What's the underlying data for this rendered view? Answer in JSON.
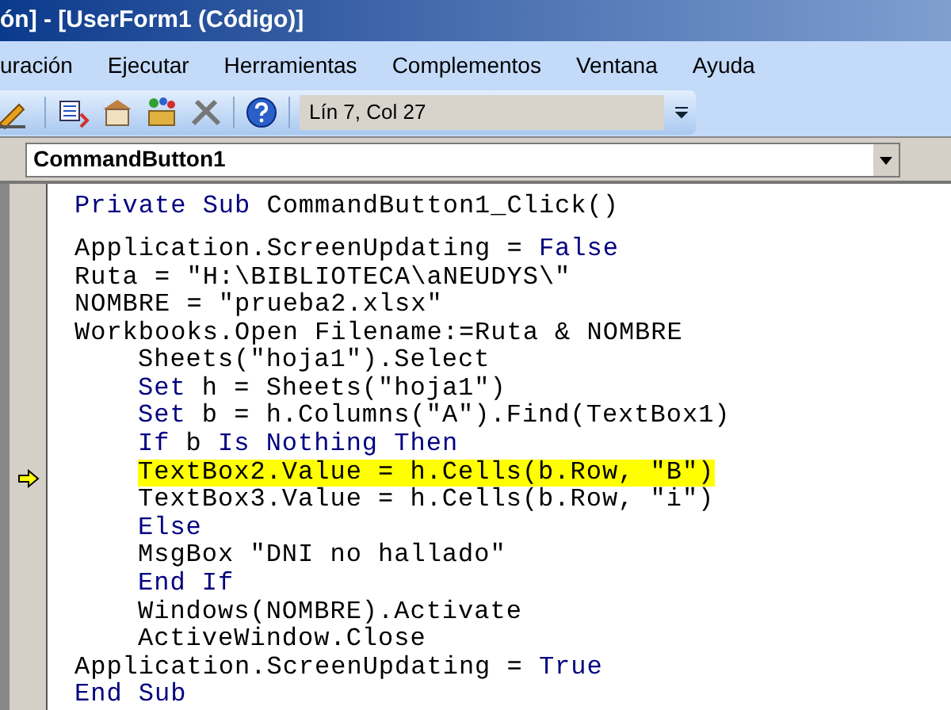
{
  "window": {
    "title": "ón] - [UserForm1 (Código)]"
  },
  "menu": [
    "uración",
    "Ejecutar",
    "Herramientas",
    "Complementos",
    "Ventana",
    "Ayuda"
  ],
  "toolbar": {
    "position": "Lín 7, Col 27"
  },
  "object_dropdown": {
    "value": "CommandButton1"
  },
  "code": [
    {
      "kind": "code",
      "current": false,
      "tokens": [
        {
          "kind": "keyword",
          "text": "Private Sub"
        },
        {
          "kind": "text",
          "text": " CommandButton1_Click()"
        }
      ]
    },
    {
      "kind": "blank"
    },
    {
      "kind": "code",
      "current": false,
      "tokens": [
        {
          "kind": "text",
          "text": "Application.ScreenUpdating = "
        },
        {
          "kind": "keyword",
          "text": "False"
        }
      ]
    },
    {
      "kind": "code",
      "current": false,
      "tokens": [
        {
          "kind": "text",
          "text": "Ruta = \"H:\\BIBLIOTECA\\aNEUDYS\\\""
        }
      ]
    },
    {
      "kind": "code",
      "current": false,
      "tokens": [
        {
          "kind": "text",
          "text": "NOMBRE = \"prueba2.xlsx\""
        }
      ]
    },
    {
      "kind": "code",
      "current": false,
      "tokens": [
        {
          "kind": "text",
          "text": "Workbooks.Open Filename:=Ruta & NOMBRE"
        }
      ],
      "children": [
        {
          "kind": "code",
          "current": false,
          "tokens": [
            {
              "kind": "text",
              "text": "Sheets(\"hoja1\").Select"
            }
          ]
        },
        {
          "kind": "code",
          "current": false,
          "tokens": [
            {
              "kind": "keyword",
              "text": "Set"
            },
            {
              "kind": "text",
              "text": " h = Sheets(\"hoja1\")"
            }
          ]
        },
        {
          "kind": "code",
          "current": false,
          "tokens": [
            {
              "kind": "keyword",
              "text": "Set"
            },
            {
              "kind": "text",
              "text": " b = h.Columns(\"A\").Find(TextBox1)"
            }
          ]
        },
        {
          "kind": "code",
          "current": false,
          "tokens": [
            {
              "kind": "keyword",
              "text": "If"
            },
            {
              "kind": "text",
              "text": " b "
            },
            {
              "kind": "keyword",
              "text": "Is Nothing Then"
            }
          ]
        },
        {
          "kind": "code",
          "current": true,
          "tokens": [
            {
              "kind": "text",
              "text": "TextBox2.Value = h.Cells(b.Row, \"B\")"
            }
          ]
        },
        {
          "kind": "code",
          "current": false,
          "tokens": [
            {
              "kind": "text",
              "text": "TextBox3.Value = h.Cells(b.Row, \"i\")"
            }
          ]
        },
        {
          "kind": "code",
          "current": false,
          "tokens": [
            {
              "kind": "keyword",
              "text": "Else"
            }
          ]
        },
        {
          "kind": "code",
          "current": false,
          "tokens": [
            {
              "kind": "text",
              "text": "MsgBox \"DNI no hallado\""
            }
          ]
        },
        {
          "kind": "code",
          "current": false,
          "tokens": [
            {
              "kind": "keyword",
              "text": "End If"
            }
          ]
        },
        {
          "kind": "code",
          "current": false,
          "tokens": [
            {
              "kind": "text",
              "text": "Windows(NOMBRE).Activate"
            }
          ]
        },
        {
          "kind": "code",
          "current": false,
          "tokens": [
            {
              "kind": "text",
              "text": "ActiveWindow.Close"
            }
          ]
        }
      ]
    },
    {
      "kind": "code",
      "current": false,
      "tokens": [
        {
          "kind": "text",
          "text": "Application.ScreenUpdating = "
        },
        {
          "kind": "keyword",
          "text": "True"
        }
      ]
    },
    {
      "kind": "code",
      "current": false,
      "tokens": [
        {
          "kind": "keyword",
          "text": "End Sub"
        }
      ]
    }
  ]
}
